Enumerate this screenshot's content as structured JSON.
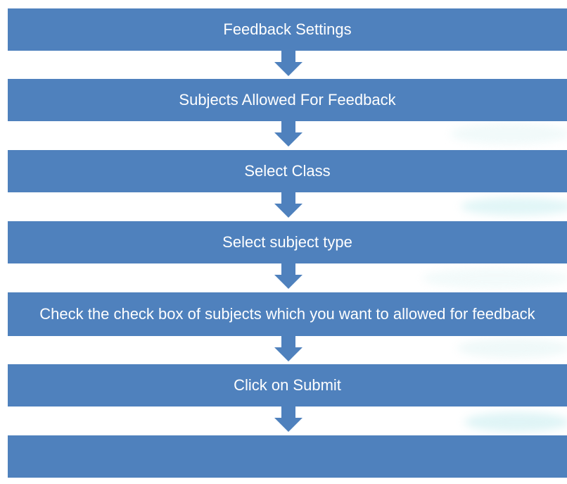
{
  "flowchart": {
    "steps": [
      {
        "label": "Feedback Settings"
      },
      {
        "label": "Subjects Allowed For Feedback"
      },
      {
        "label": "Select Class"
      },
      {
        "label": "Select subject type"
      },
      {
        "label": "Check the check box of subjects which you want to allowed for feedback"
      },
      {
        "label": "Click on Submit"
      },
      {
        "label": ""
      }
    ],
    "colors": {
      "box_fill": "#4f81bd",
      "arrow_fill": "#4f81bd",
      "text": "#ffffff"
    }
  }
}
